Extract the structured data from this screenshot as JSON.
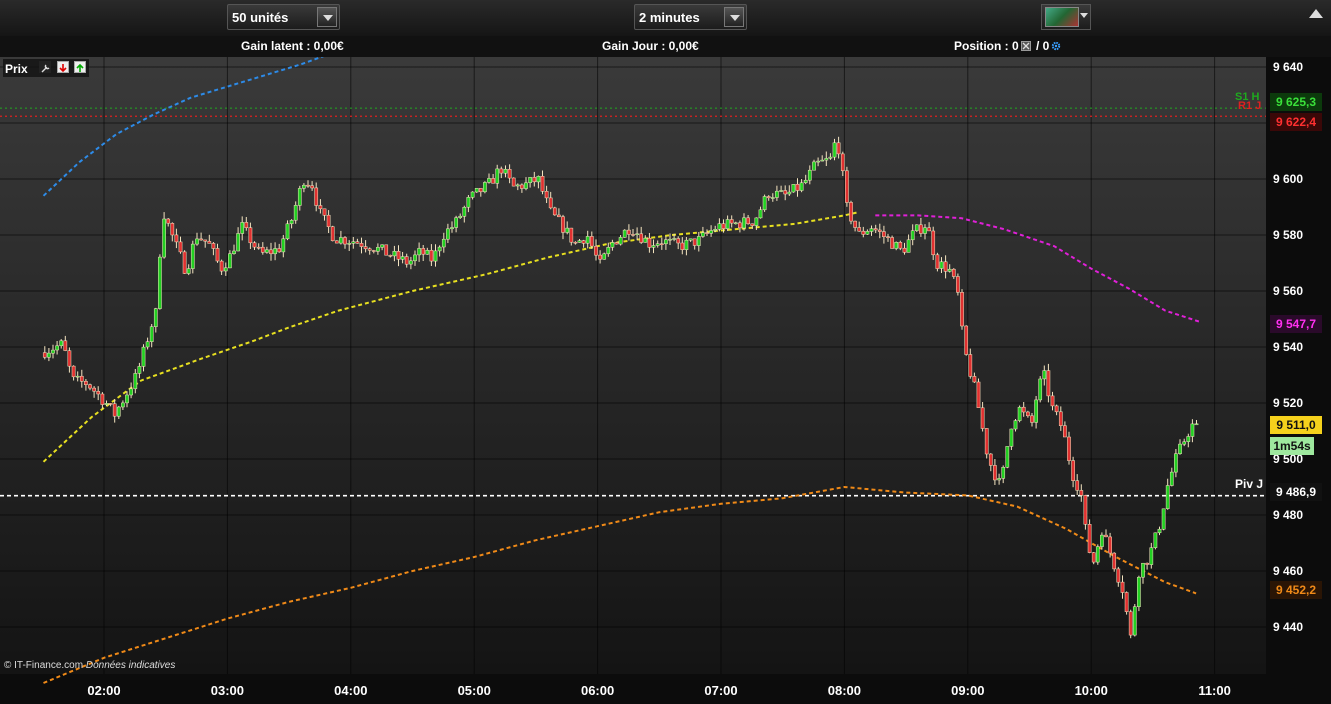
{
  "toolbar": {
    "quantity_value": "50 unités",
    "timeframe_value": "2 minutes"
  },
  "info": {
    "gain_latent": "Gain latent : 0,00€",
    "gain_jour": "Gain Jour : 0,00€",
    "position_label": "Position : 0",
    "position_sep": "/ 0"
  },
  "legend": {
    "prix": "Prix"
  },
  "copyright": {
    "brand": "© IT-Finance.com",
    "note": "Données indicatives"
  },
  "colors": {
    "background_top": "#3a3a3a",
    "background_bottom": "#141414",
    "up_candle": "#22d022",
    "down_candle": "#e03030",
    "wick": "#ffffff",
    "ma_blue": "#2d8be8",
    "ma_yellow": "#e8e020",
    "ma_magenta": "#e020d8",
    "ma_orange": "#f08a18",
    "pivot": "#ffffff",
    "s1": "#1faa1f",
    "r1": "#e02020"
  },
  "levels": {
    "s1": {
      "label": "S1 H",
      "value": 9625.3,
      "tag": "9 625,3",
      "color": "#1faa1f"
    },
    "r1": {
      "label": "R1 J",
      "value": 9622.4,
      "tag": "9 622,4",
      "color": "#e02020"
    },
    "pivot": {
      "label": "Piv J",
      "value": 9486.9,
      "tag": "9 486,9"
    },
    "ma_magenta": {
      "tag": "9 547,7",
      "color": "#e020d8"
    },
    "last": {
      "tag": "9 511,0",
      "color": "#f5d11c"
    },
    "countdown": {
      "tag": "1m54s",
      "color": "#9ee89e"
    },
    "ma_orange": {
      "tag": "9 452,2",
      "color": "#f08a18"
    }
  },
  "chart_data": {
    "type": "candlestick",
    "timeframe": "2 minutes",
    "y_ticks": [
      "9 640",
      "9 620",
      "9 600",
      "9 580",
      "9 560",
      "9 540",
      "9 520",
      "9 500",
      "9 480",
      "9 460",
      "9 440"
    ],
    "y_tick_values": [
      9640,
      9620,
      9600,
      9580,
      9560,
      9540,
      9520,
      9500,
      9480,
      9460,
      9440
    ],
    "x_ticks": [
      "02:00",
      "03:00",
      "04:00",
      "05:00",
      "06:00",
      "07:00",
      "08:00",
      "09:00",
      "10:00",
      "11:00"
    ],
    "x_tick_hours": [
      2,
      3,
      4,
      5,
      6,
      7,
      8,
      9,
      10,
      11
    ],
    "ylim": [
      9423,
      9644
    ],
    "xlim_hours": [
      1.51,
      11.6
    ],
    "price_path": [
      [
        1.52,
        9538
      ],
      [
        1.7,
        9541
      ],
      [
        1.78,
        9528
      ],
      [
        1.9,
        9527
      ],
      [
        2.05,
        9520
      ],
      [
        2.12,
        9516
      ],
      [
        2.2,
        9522
      ],
      [
        2.3,
        9530
      ],
      [
        2.42,
        9548
      ],
      [
        2.47,
        9554
      ],
      [
        2.5,
        9590
      ],
      [
        2.6,
        9578
      ],
      [
        2.7,
        9567
      ],
      [
        2.78,
        9580
      ],
      [
        2.88,
        9577
      ],
      [
        2.98,
        9568
      ],
      [
        3.05,
        9572
      ],
      [
        3.15,
        9583
      ],
      [
        3.3,
        9573
      ],
      [
        3.45,
        9575
      ],
      [
        3.55,
        9585
      ],
      [
        3.65,
        9600
      ],
      [
        3.72,
        9598
      ],
      [
        3.78,
        9588
      ],
      [
        3.9,
        9579
      ],
      [
        4.05,
        9578
      ],
      [
        4.2,
        9576
      ],
      [
        4.35,
        9573
      ],
      [
        4.5,
        9570
      ],
      [
        4.6,
        9574
      ],
      [
        4.7,
        9571
      ],
      [
        4.78,
        9580
      ],
      [
        4.88,
        9584
      ],
      [
        5.0,
        9593
      ],
      [
        5.15,
        9598
      ],
      [
        5.25,
        9604
      ],
      [
        5.35,
        9597
      ],
      [
        5.45,
        9598
      ],
      [
        5.55,
        9600
      ],
      [
        5.65,
        9588
      ],
      [
        5.75,
        9583
      ],
      [
        5.85,
        9577
      ],
      [
        5.95,
        9580
      ],
      [
        6.05,
        9569
      ],
      [
        6.15,
        9577
      ],
      [
        6.3,
        9583
      ],
      [
        6.45,
        9577
      ],
      [
        6.55,
        9578
      ],
      [
        6.7,
        9576
      ],
      [
        6.85,
        9578
      ],
      [
        7.0,
        9583
      ],
      [
        7.15,
        9584
      ],
      [
        7.3,
        9585
      ],
      [
        7.42,
        9595
      ],
      [
        7.55,
        9594
      ],
      [
        7.7,
        9598
      ],
      [
        7.8,
        9605
      ],
      [
        7.92,
        9607
      ],
      [
        7.97,
        9615
      ],
      [
        8.0,
        9608
      ],
      [
        8.05,
        9590
      ],
      [
        8.15,
        9580
      ],
      [
        8.25,
        9583
      ],
      [
        8.4,
        9578
      ],
      [
        8.5,
        9574
      ],
      [
        8.6,
        9581
      ],
      [
        8.7,
        9584
      ],
      [
        8.78,
        9570
      ],
      [
        8.88,
        9568
      ],
      [
        8.95,
        9560
      ],
      [
        9.0,
        9540
      ],
      [
        9.1,
        9523
      ],
      [
        9.2,
        9500
      ],
      [
        9.3,
        9490
      ],
      [
        9.38,
        9512
      ],
      [
        9.45,
        9518
      ],
      [
        9.55,
        9512
      ],
      [
        9.6,
        9525
      ],
      [
        9.65,
        9530
      ],
      [
        9.72,
        9518
      ],
      [
        9.8,
        9511
      ],
      [
        9.88,
        9495
      ],
      [
        9.95,
        9488
      ],
      [
        10.0,
        9470
      ],
      [
        10.05,
        9463
      ],
      [
        10.12,
        9475
      ],
      [
        10.2,
        9465
      ],
      [
        10.3,
        9452
      ],
      [
        10.35,
        9435
      ],
      [
        10.42,
        9460
      ],
      [
        10.5,
        9465
      ],
      [
        10.58,
        9475
      ],
      [
        10.65,
        9490
      ],
      [
        10.72,
        9500
      ],
      [
        10.8,
        9508
      ],
      [
        10.85,
        9512
      ],
      [
        10.88,
        9511
      ]
    ],
    "series": [
      {
        "name": "MA blue",
        "color": "#2d8be8",
        "points": [
          [
            1.51,
            9594
          ],
          [
            1.8,
            9606
          ],
          [
            2.1,
            9616
          ],
          [
            2.4,
            9623
          ],
          [
            2.7,
            9629
          ],
          [
            3.0,
            9633
          ],
          [
            3.3,
            9637
          ],
          [
            3.6,
            9641
          ],
          [
            3.85,
            9645
          ]
        ]
      },
      {
        "name": "MA yellow",
        "color": "#e8e020",
        "points": [
          [
            1.51,
            9499
          ],
          [
            1.9,
            9515
          ],
          [
            2.3,
            9528
          ],
          [
            2.8,
            9536
          ],
          [
            3.2,
            9542
          ],
          [
            3.5,
            9547
          ],
          [
            3.9,
            9553
          ],
          [
            4.5,
            9560
          ],
          [
            5.1,
            9566
          ],
          [
            5.6,
            9572
          ],
          [
            6.1,
            9577
          ],
          [
            6.6,
            9580
          ],
          [
            7.1,
            9582
          ],
          [
            7.6,
            9584
          ],
          [
            8.0,
            9587
          ],
          [
            8.1,
            9588
          ]
        ]
      },
      {
        "name": "MA magenta",
        "color": "#e020d8",
        "points": [
          [
            8.25,
            9587
          ],
          [
            8.6,
            9587
          ],
          [
            8.95,
            9586
          ],
          [
            9.3,
            9582
          ],
          [
            9.7,
            9576
          ],
          [
            10.0,
            9568
          ],
          [
            10.3,
            9561
          ],
          [
            10.6,
            9553
          ],
          [
            10.88,
            9549
          ]
        ]
      },
      {
        "name": "MA orange",
        "color": "#f08a18",
        "points": [
          [
            1.51,
            9420
          ],
          [
            2.0,
            9429
          ],
          [
            2.5,
            9436
          ],
          [
            3.0,
            9443
          ],
          [
            3.5,
            9449
          ],
          [
            4.0,
            9454
          ],
          [
            4.5,
            9460
          ],
          [
            5.0,
            9465
          ],
          [
            5.5,
            9471
          ],
          [
            6.0,
            9476
          ],
          [
            6.5,
            9481
          ],
          [
            7.0,
            9484
          ],
          [
            7.5,
            9486
          ],
          [
            8.0,
            9490
          ],
          [
            8.5,
            9488
          ],
          [
            9.0,
            9487
          ],
          [
            9.4,
            9483
          ],
          [
            9.8,
            9475
          ],
          [
            10.2,
            9465
          ],
          [
            10.6,
            9456
          ],
          [
            10.85,
            9452
          ]
        ]
      }
    ]
  }
}
